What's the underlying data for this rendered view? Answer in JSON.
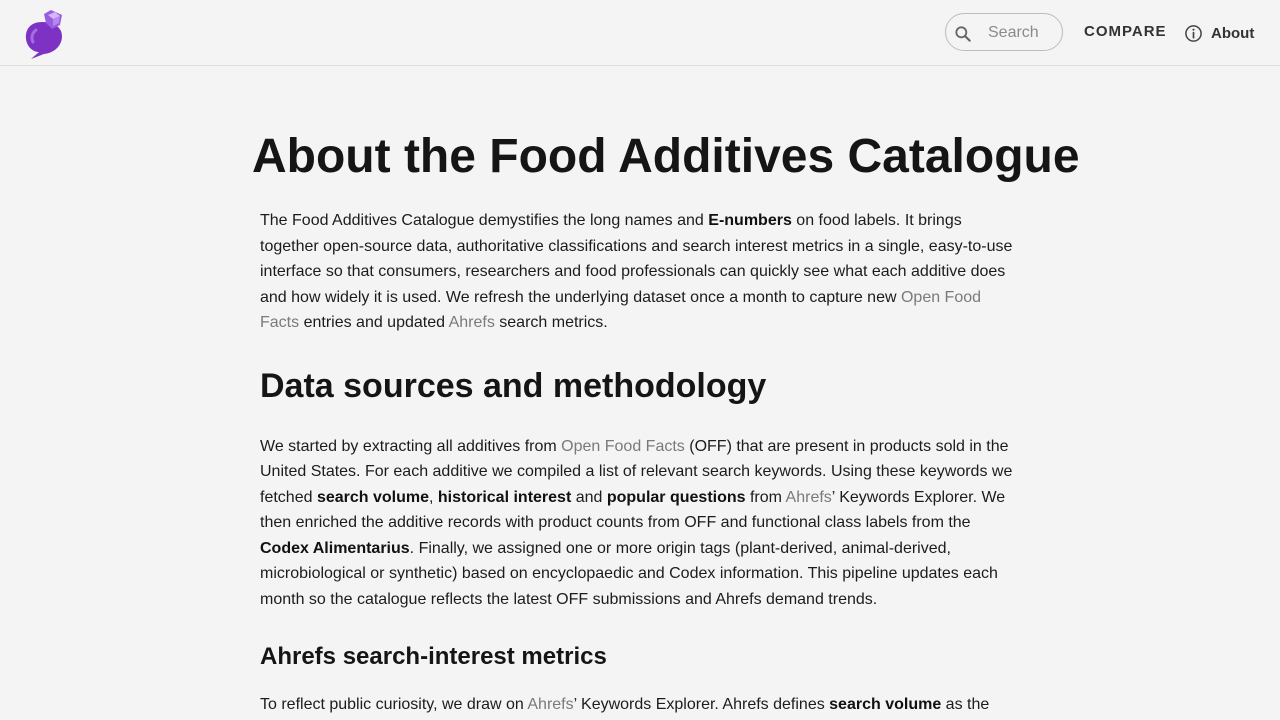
{
  "header": {
    "search_placeholder": "Search",
    "nav_compare": "COMPARE",
    "nav_about": "About"
  },
  "main": {
    "title": "About the Food Additives Catalogue",
    "intro": {
      "t1": "The Food Additives Catalogue demystifies the long names and ",
      "b1": "E-numbers",
      "t2": " on food labels. It brings together open-source data, authoritative classifications and search interest metrics in a single, easy-to-use interface so that consumers, researchers and food professionals can quickly see what each additive does and how widely it is used. We refresh the underlying dataset once a month to capture new ",
      "l1": "Open Food Facts",
      "t3": " entries and updated ",
      "l2": "Ahrefs",
      "t4": " search metrics."
    },
    "section1": {
      "heading": "Data sources and methodology",
      "t1": "We started by extracting all additives from ",
      "l1": "Open Food Facts",
      "t2": " (OFF) that are present in products sold in the United States. For each additive we compiled a list of relevant search keywords. Using these keywords we fetched ",
      "b1": "search volume",
      "t3": ", ",
      "b2": "historical interest",
      "t4": " and ",
      "b3": "popular questions",
      "t5": " from ",
      "l2": "Ahrefs",
      "t6": "’ Keywords Explorer. We then enriched the additive records with product counts from OFF and functional class labels from the ",
      "b4": "Codex Alimentarius",
      "t7": ". Finally, we assigned one or more origin tags (plant-derived, animal-derived, microbiological or synthetic) based on encyclopaedic and Codex information. This pipeline updates each month so the catalogue reflects the latest OFF submissions and Ahrefs demand trends."
    },
    "section2": {
      "heading": "Ahrefs search-interest metrics",
      "t1": "To reflect public curiosity, we draw on ",
      "l1": "Ahrefs",
      "t2": "’ Keywords Explorer. Ahrefs defines ",
      "b1": "search volume",
      "t3": " as the"
    }
  }
}
